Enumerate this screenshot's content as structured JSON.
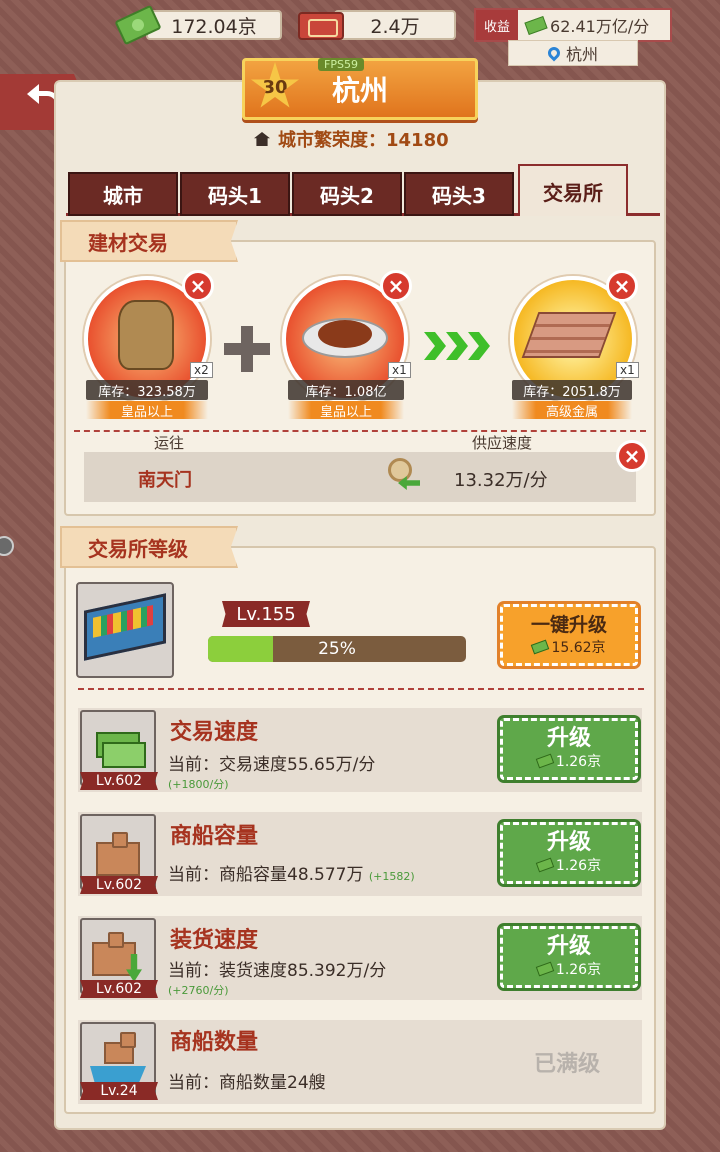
{
  "topbar": {
    "currency": "172.04京",
    "tickets": "2.4万",
    "income_label": "收益",
    "income_value": "62.41万亿/分",
    "location": "杭州"
  },
  "city": {
    "level": "30",
    "name": "杭州",
    "fps": "FPS59",
    "prosperity": "城市繁荣度：14180"
  },
  "tabs": [
    "城市",
    "码头1",
    "码头2",
    "码头3",
    "交易所"
  ],
  "trade": {
    "title": "建材交易",
    "inputs": [
      {
        "qty": "x2",
        "stock": "库存：323.58万",
        "grade": "皇品以上"
      },
      {
        "qty": "x1",
        "stock": "库存：1.08亿",
        "grade": "皇品以上"
      }
    ],
    "output": {
      "qty": "x1",
      "stock": "库存：2051.8万",
      "grade": "高级金属"
    },
    "route_header": "运往",
    "speed_header": "供应速度",
    "route_dest": "南天门",
    "supply_speed": "13.32万/分"
  },
  "exchange": {
    "title": "交易所等级",
    "level": "Lv.155",
    "progress_text": "25%",
    "progress_pct": 25,
    "oneclick_label": "一键升级",
    "oneclick_cost": "15.62京"
  },
  "upgrades": [
    {
      "lv": "Lv.602",
      "title": "交易速度",
      "desc": "当前：交易速度55.65万/分",
      "delta": "(+1800/分)",
      "btn": "升级",
      "cost": "1.26京"
    },
    {
      "lv": "Lv.602",
      "title": "商船容量",
      "desc": "当前：商船容量48.577万",
      "delta": "(+1582)",
      "btn": "升级",
      "cost": "1.26京"
    },
    {
      "lv": "Lv.602",
      "title": "装货速度",
      "desc": "当前：装货速度85.392万/分",
      "delta": "(+2760/分)",
      "btn": "升级",
      "cost": "1.26京"
    },
    {
      "lv": "Lv.24",
      "title": "商船数量",
      "desc": "当前：商船数量24艘",
      "maxed": "已满级"
    }
  ],
  "colors": {
    "accent_red": "#a6331f",
    "tab_dark": "#6b2a24",
    "upgrade_green": "#5fa84a",
    "oneclick_orange": "#f7a12b"
  }
}
